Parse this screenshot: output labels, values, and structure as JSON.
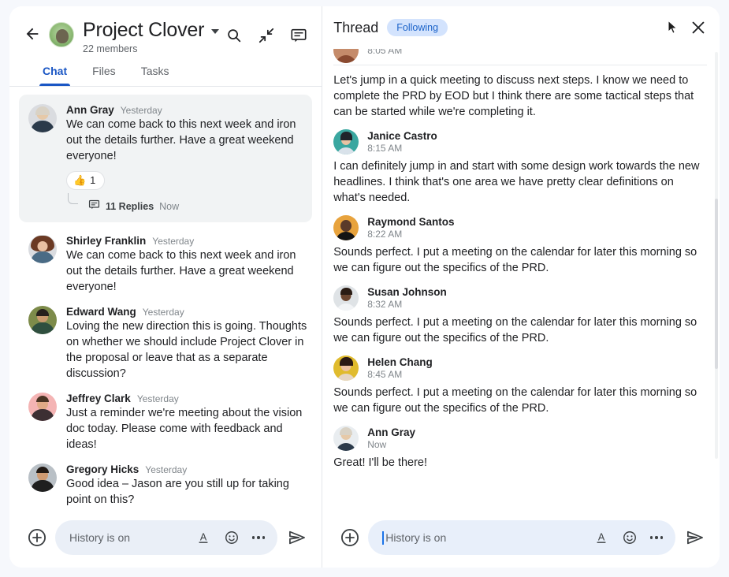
{
  "room": {
    "title": "Project Clover",
    "members": "22 members",
    "back_icon": "back-arrow-icon",
    "avatar_icon": "room-avatar",
    "dropdown_icon": "chevron-down-icon",
    "actions": [
      {
        "name": "search-icon",
        "label": "Search"
      },
      {
        "name": "collapse-icon",
        "label": "Collapse"
      },
      {
        "name": "chat-icon",
        "label": "Chat"
      }
    ],
    "tabs": [
      {
        "label": "Chat",
        "active": true
      },
      {
        "label": "Files",
        "active": false
      },
      {
        "label": "Tasks",
        "active": false
      }
    ]
  },
  "messages": [
    {
      "author": "Ann Gray",
      "time": "Yesterday",
      "text": "We can come back to this next week and iron out the details further. Have a great weekend everyone!",
      "highlighted": true,
      "reaction": {
        "emoji": "thumbs-up",
        "count": "1"
      },
      "replies": {
        "count": "11 Replies",
        "time": "Now"
      }
    },
    {
      "author": "Shirley Franklin",
      "time": "Yesterday",
      "text": "We can come back to this next week and iron out the details further. Have a great weekend everyone!"
    },
    {
      "author": "Edward Wang",
      "time": "Yesterday",
      "text": "Loving the new direction this is going. Thoughts on whether we should include Project Clover in the proposal or leave that as a separate discussion?"
    },
    {
      "author": "Jeffrey Clark",
      "time": "Yesterday",
      "text": "Just a reminder we're meeting about the vision doc today. Please come with feedback and ideas!"
    },
    {
      "author": "Gregory Hicks",
      "time": "Yesterday",
      "text": "Good idea – Jason are you still up for taking point on this?"
    }
  ],
  "composer": {
    "add_icon": "plus-circle-icon",
    "placeholder": "History is on",
    "value": "",
    "format_icon": "format-text-icon",
    "emoji_icon": "emoji-icon",
    "more_icon": "more-options-icon",
    "send_icon": "send-icon"
  },
  "thread": {
    "title": "Thread",
    "following_label": "Following",
    "cursor_icon": "mouse-pointer-icon",
    "close_icon": "close-icon",
    "messages": [
      {
        "author": "",
        "time": "8:05 AM",
        "text": "Let's jump in a quick meeting to discuss next steps. I know we need to complete the PRD by EOD but I think there are some tactical steps that can be started while we're completing it.",
        "clipped": true
      },
      {
        "author": "Janice Castro",
        "time": "8:15 AM",
        "text": "I can definitely jump in and start with some design work towards the new headlines. I think that's one area we have pretty clear definitions on what's needed."
      },
      {
        "author": "Raymond Santos",
        "time": "8:22 AM",
        "text": "Sounds perfect. I put a meeting on the calendar for later this morning so we can figure out the specifics of the PRD."
      },
      {
        "author": "Susan Johnson",
        "time": "8:32 AM",
        "text": "Sounds perfect. I put a meeting on the calendar for later this morning so we can figure out the specifics of the PRD."
      },
      {
        "author": "Helen Chang",
        "time": "8:45 AM",
        "text": "Sounds perfect. I put a meeting on the calendar for later this morning so we can figure out the specifics of the PRD."
      },
      {
        "author": "Ann Gray",
        "time": "Now",
        "text": "Great! I'll be there!"
      }
    ],
    "composer": {
      "add_icon": "plus-circle-icon",
      "placeholder": "History is on",
      "value": "",
      "format_icon": "format-text-icon",
      "emoji_icon": "emoji-icon",
      "more_icon": "more-options-icon",
      "send_icon": "send-icon",
      "focused": true
    }
  },
  "colors": {
    "accent": "#1a56c4",
    "pill_bg": "#d3e3fd",
    "pill_text": "#1b63c9",
    "card_bg": "#f1f3f4",
    "input_bg": "#eaeff7",
    "page_bg": "#f6f8fc"
  }
}
